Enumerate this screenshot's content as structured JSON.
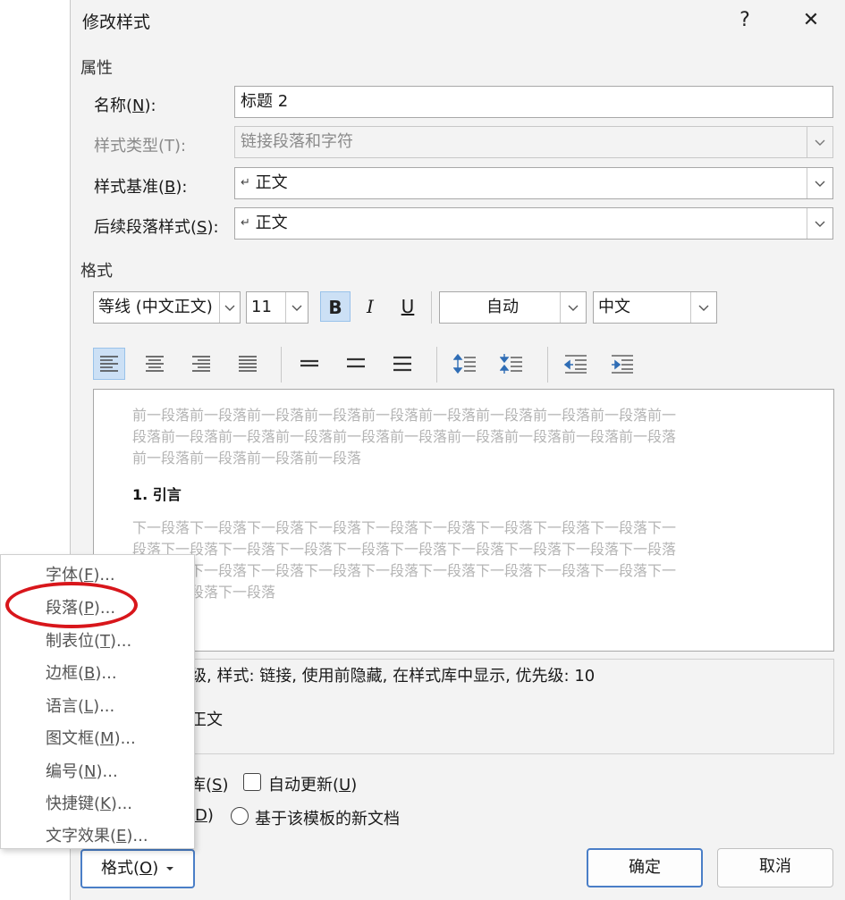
{
  "dialog": {
    "title": "修改样式",
    "help": "?",
    "close": "✕"
  },
  "properties": {
    "section": "属性",
    "name_label": "名称(N):",
    "name_value": "标题 2",
    "type_label": "样式类型(T):",
    "type_value": "链接段落和字符",
    "base_label": "样式基准(B):",
    "base_value": "正文",
    "next_label": "后续段落样式(S):",
    "next_value": "正文",
    "para_mark": "↵"
  },
  "format": {
    "section": "格式",
    "font": "等线 (中文正文)",
    "size": "11",
    "bold": "B",
    "italic": "I",
    "underline": "U",
    "color": "自动",
    "lang": "中文"
  },
  "preview": {
    "before_lines": [
      "前一段落前一段落前一段落前一段落前一段落前一段落前一段落前一段落前一段落前一",
      "段落前一段落前一段落前一段落前一段落前一段落前一段落前一段落前一段落前一段落",
      "前一段落前一段落前一段落前一段落"
    ],
    "heading": "1.  引言",
    "after_lines": [
      "下一段落下一段落下一段落下一段落下一段落下一段落下一段落下一段落下一段落下一",
      "段落下一段落下一段落下一段落下一段落下一段落下一段落下一段落下一段落下一段落",
      "下一段落下一段落下一段落下一段落下一段落下一段落下一段落下一段落下一段落下一",
      "段落下一段落下一段落"
    ]
  },
  "description": {
    "line1": "级, 样式: 链接, 使用前隐藏, 在样式库中显示, 优先级: 10",
    "line2": "正文"
  },
  "options": {
    "gallery_tail": "库(S)",
    "auto_update": "自动更新(U)",
    "doc_tail": "D)",
    "template": "基于该模板的新文档"
  },
  "buttons": {
    "format": "格式(O)",
    "ok": "确定",
    "cancel": "取消"
  },
  "menu": {
    "items": [
      "字体(F)...",
      "段落(P)...",
      "制表位(T)...",
      "边框(B)...",
      "语言(L)...",
      "图文框(M)...",
      "编号(N)...",
      "快捷键(K)...",
      "文字效果(E)..."
    ]
  },
  "colors": {
    "highlight": "#d8161b",
    "accent": "#4a7ec7"
  }
}
